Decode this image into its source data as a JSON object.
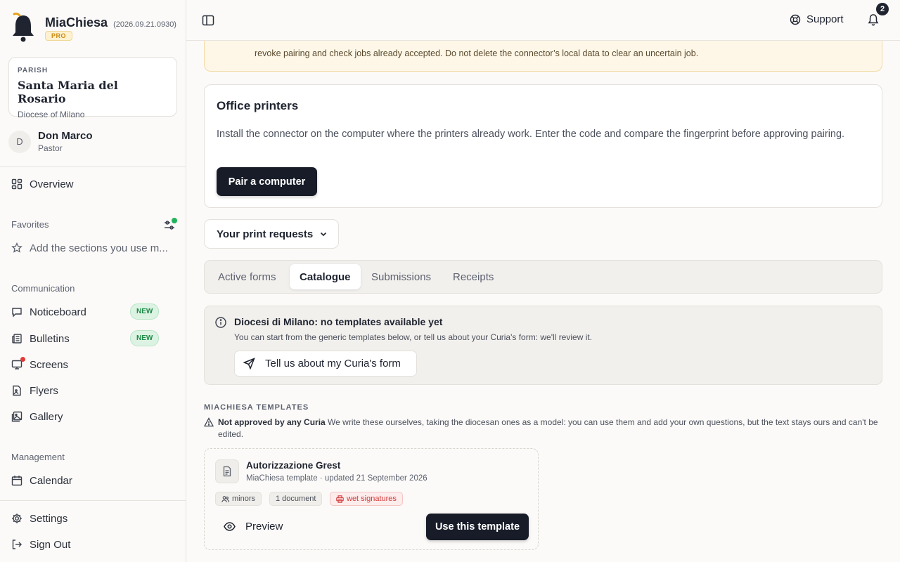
{
  "brand": {
    "name": "MiaChiesa",
    "version": "(2026.09.21.0930)",
    "plan": "PRO"
  },
  "parish": {
    "kicker": "PARISH",
    "name": "Santa Maria del Rosario",
    "diocese": "Diocese of Milano"
  },
  "user": {
    "initial": "D",
    "name": "Don Marco",
    "role": "Pastor"
  },
  "nav": {
    "overview": "Overview",
    "favorites_label": "Favorites",
    "favorites_hint": "Add the sections you use m...",
    "communication_label": "Communication",
    "noticeboard": "Noticeboard",
    "bulletins": "Bulletins",
    "new_badge": "NEW",
    "screens": "Screens",
    "flyers": "Flyers",
    "gallery": "Gallery",
    "management_label": "Management",
    "calendar": "Calendar",
    "settings": "Settings",
    "sign_out": "Sign Out"
  },
  "topbar": {
    "support": "Support",
    "notifications_count": "2"
  },
  "warning": {
    "text": "revoke pairing and check jobs already accepted. Do not delete the connector’s local data to clear an uncertain job."
  },
  "printers": {
    "title": "Office printers",
    "body": "Install the connector on the computer where the printers already work. Enter the code and compare the fingerprint before approving pairing.",
    "button": "Pair a computer"
  },
  "requests_dropdown": "Your print requests",
  "tabs": [
    "Active forms",
    "Catalogue",
    "Submissions",
    "Receipts"
  ],
  "active_tab": "Catalogue",
  "notice": {
    "title": "Diocesi di Milano: no templates available yet",
    "subtitle": "You can start from the generic templates below, or tell us about your Curia's form: we'll review it.",
    "button": "Tell us about my Curia's form"
  },
  "templates": {
    "heading": "MIACHIESA TEMPLATES",
    "note_bold": "Not approved by any Curia",
    "note_text": " We write these ourselves, taking the diocesan ones as a model: you can use them and add your own questions, but the text stays ours and can't be edited.",
    "items": [
      {
        "title": "Autorizzazione Grest",
        "meta": "MiaChiesa template · updated 21 September 2026",
        "chips": [
          "minors",
          "1 document",
          "wet signatures"
        ],
        "preview": "Preview",
        "use": "Use this template"
      }
    ]
  },
  "colors": {
    "primary": "#171c28",
    "accent_green": "#22b35a",
    "alert_red": "#e03a3a",
    "warning_bg": "#fef7e8",
    "pro_gold": "#c98a12"
  }
}
